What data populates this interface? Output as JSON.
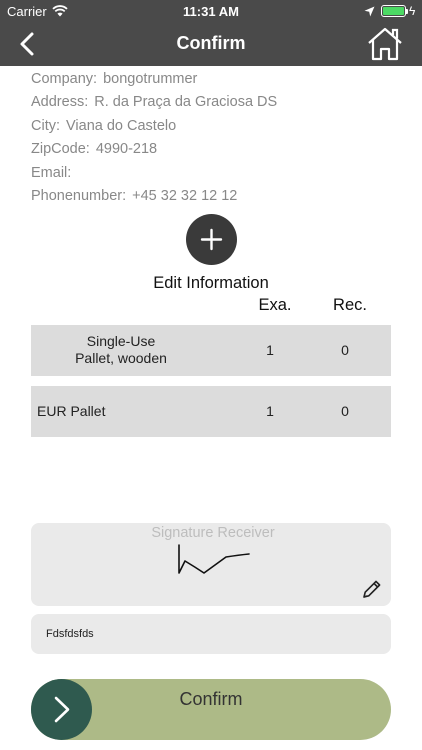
{
  "status_bar": {
    "carrier": "Carrier",
    "time": "11:31 AM",
    "battery_level": 1.0
  },
  "nav": {
    "title": "Confirm",
    "back_icon": "chevron-left-icon",
    "home_icon": "home-icon"
  },
  "info": [
    {
      "label": "Company:",
      "value": "bongotrummer"
    },
    {
      "label": "Address:",
      "value": "R. da Praça da Graciosa DS"
    },
    {
      "label": "City:",
      "value": "Viana do Castelo"
    },
    {
      "label": "ZipCode:",
      "value": "4990-218"
    },
    {
      "label": "Email:",
      "value": ""
    },
    {
      "label": "Phonenumber:",
      "value": "+45 32 32 12 12"
    }
  ],
  "edit": {
    "label": "Edit Information"
  },
  "table": {
    "headers": {
      "exa": "Exa.",
      "rec": "Rec."
    },
    "rows": [
      {
        "line1": "Single-Use",
        "line2": "Pallet, wooden",
        "exa": "1",
        "rec": "0"
      },
      {
        "name": "EUR Pallet",
        "exa": "1",
        "rec": "0"
      }
    ]
  },
  "signature": {
    "placeholder": "Signature Receiver"
  },
  "receiver_name": {
    "value": "Fdsfdsfds"
  },
  "confirm": {
    "label": "Confirm"
  },
  "colors": {
    "bar": "#4a4a4a",
    "row": "#dcdcdc",
    "field": "#eaeaea",
    "slider": "#adba87",
    "knob": "#2f5a4f"
  }
}
